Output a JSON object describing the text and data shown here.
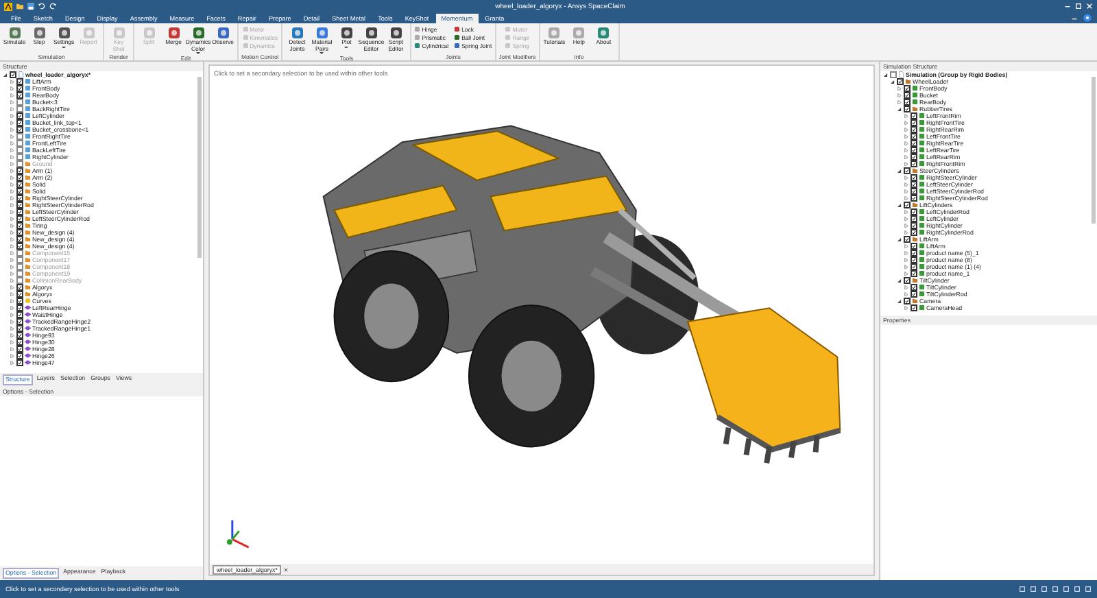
{
  "window": {
    "title": "wheel_loader_algoryx - Ansys SpaceClaim"
  },
  "menu_tabs": [
    {
      "label": "File",
      "selected": false
    },
    {
      "label": "Sketch",
      "selected": false
    },
    {
      "label": "Design",
      "selected": false
    },
    {
      "label": "Display",
      "selected": false
    },
    {
      "label": "Assembly",
      "selected": false
    },
    {
      "label": "Measure",
      "selected": false
    },
    {
      "label": "Facets",
      "selected": false
    },
    {
      "label": "Repair",
      "selected": false
    },
    {
      "label": "Prepare",
      "selected": false
    },
    {
      "label": "Detail",
      "selected": false
    },
    {
      "label": "Sheet Metal",
      "selected": false
    },
    {
      "label": "Tools",
      "selected": false
    },
    {
      "label": "KeyShot",
      "selected": false
    },
    {
      "label": "Momentum",
      "selected": true
    },
    {
      "label": "Granta",
      "selected": false
    }
  ],
  "ribbon_groups": [
    {
      "label": "Simulation",
      "buttons": [
        {
          "label": "Simulate",
          "kind": "large",
          "disabled": false,
          "dropdown": false
        },
        {
          "label": "Step",
          "kind": "large",
          "disabled": false,
          "dropdown": false
        },
        {
          "label": "Settings",
          "kind": "large",
          "disabled": false,
          "dropdown": true
        },
        {
          "label": "Report",
          "kind": "large",
          "disabled": true,
          "dropdown": false
        }
      ]
    },
    {
      "label": "Render",
      "buttons": [
        {
          "label": "Key Shot",
          "kind": "large",
          "disabled": true,
          "dropdown": false
        }
      ]
    },
    {
      "label": "Edit",
      "buttons": [
        {
          "label": "Split",
          "kind": "large",
          "disabled": true,
          "dropdown": false
        },
        {
          "label": "Merge",
          "kind": "large",
          "disabled": false,
          "dropdown": false
        },
        {
          "label": "Dynamics Color",
          "kind": "large",
          "disabled": false,
          "dropdown": true
        },
        {
          "label": "Observe",
          "kind": "large",
          "disabled": false,
          "dropdown": false
        }
      ]
    },
    {
      "label": "Motion Control",
      "buttons": [
        {
          "label": "Motor",
          "kind": "small",
          "disabled": true,
          "dropdown": false
        },
        {
          "label": "Kinematics",
          "kind": "small",
          "disabled": true,
          "dropdown": false
        },
        {
          "label": "Dynamics",
          "kind": "small",
          "disabled": true,
          "dropdown": false
        }
      ]
    },
    {
      "label": "Tools",
      "buttons": [
        {
          "label": "Detect Joints",
          "kind": "large",
          "disabled": false,
          "dropdown": false
        },
        {
          "label": "Material Pairs",
          "kind": "large",
          "disabled": false,
          "dropdown": true
        },
        {
          "label": "Plot",
          "kind": "large",
          "disabled": false,
          "dropdown": true
        },
        {
          "label": "Sequence Editor",
          "kind": "large",
          "disabled": false,
          "dropdown": false
        },
        {
          "label": "Script Editor",
          "kind": "large",
          "disabled": false,
          "dropdown": false
        }
      ]
    },
    {
      "label": "Joints",
      "buttons": [
        {
          "label": "Hinge",
          "kind": "small",
          "disabled": false,
          "dropdown": false
        },
        {
          "label": "Prismatic",
          "kind": "small",
          "disabled": false,
          "dropdown": false
        },
        {
          "label": "Cylindrical",
          "kind": "small",
          "disabled": false,
          "dropdown": false
        },
        {
          "label": "Lock",
          "kind": "small",
          "disabled": false,
          "dropdown": false
        },
        {
          "label": "Ball Joint",
          "kind": "small",
          "disabled": false,
          "dropdown": false
        },
        {
          "label": "Spring Joint",
          "kind": "small",
          "disabled": false,
          "dropdown": false
        }
      ]
    },
    {
      "label": "Joint Modifiers",
      "buttons": [
        {
          "label": "Motor",
          "kind": "small",
          "disabled": true,
          "dropdown": false
        },
        {
          "label": "Range",
          "kind": "small",
          "disabled": true,
          "dropdown": false
        },
        {
          "label": "Spring",
          "kind": "small",
          "disabled": true,
          "dropdown": false
        }
      ]
    },
    {
      "label": "Info",
      "buttons": [
        {
          "label": "Tutorials",
          "kind": "large",
          "disabled": false,
          "dropdown": false
        },
        {
          "label": "Help",
          "kind": "large",
          "disabled": false,
          "dropdown": false
        },
        {
          "label": "About",
          "kind": "large",
          "disabled": false,
          "dropdown": false
        }
      ]
    }
  ],
  "structure_panel": {
    "title": "Structure",
    "tree": {
      "label": "wheel_loader_algoryx*",
      "kind": "document",
      "checked": true,
      "expanded": true,
      "children": [
        {
          "label": "LiftArm",
          "kind": "body",
          "checked": true,
          "expanded": false
        },
        {
          "label": "FrontBody",
          "kind": "body",
          "checked": true,
          "expanded": false
        },
        {
          "label": "RearBody",
          "kind": "body",
          "checked": true,
          "expanded": false
        },
        {
          "label": "Bucket<3",
          "kind": "body",
          "checked": false,
          "expanded": false
        },
        {
          "label": "BackRightTire",
          "kind": "body",
          "checked": false,
          "expanded": false
        },
        {
          "label": "LeftCylinder",
          "kind": "body",
          "checked": true,
          "expanded": false
        },
        {
          "label": "Bucket_link_top<1",
          "kind": "body",
          "checked": true,
          "expanded": false
        },
        {
          "label": "Bucket_crossbone<1",
          "kind": "body",
          "checked": true,
          "expanded": false
        },
        {
          "label": "FrontRightTire",
          "kind": "body",
          "checked": false,
          "expanded": false
        },
        {
          "label": "FrontLeftTire",
          "kind": "body",
          "checked": false,
          "expanded": false
        },
        {
          "label": "BackLeftTire",
          "kind": "body",
          "checked": false,
          "expanded": false
        },
        {
          "label": "RightCylinder",
          "kind": "body",
          "checked": false,
          "expanded": false
        },
        {
          "label": "Ground",
          "kind": "component",
          "checked": false,
          "expanded": false
        },
        {
          "label": "Arm (1)",
          "kind": "component",
          "checked": true,
          "expanded": false
        },
        {
          "label": "Arm (2)",
          "kind": "component",
          "checked": true,
          "expanded": false
        },
        {
          "label": "Solid",
          "kind": "component",
          "checked": true,
          "expanded": false
        },
        {
          "label": "Solid",
          "kind": "component",
          "checked": true,
          "expanded": false
        },
        {
          "label": "RightSteerCylinder",
          "kind": "component",
          "checked": true,
          "expanded": false
        },
        {
          "label": "RightSteerCylinderRod",
          "kind": "component",
          "checked": true,
          "expanded": false
        },
        {
          "label": "LeftSteerCylinder",
          "kind": "component",
          "checked": true,
          "expanded": false
        },
        {
          "label": "LeftSteerCylinderRod",
          "kind": "component",
          "checked": true,
          "expanded": false
        },
        {
          "label": "Tiring",
          "kind": "component",
          "checked": true,
          "expanded": false
        },
        {
          "label": "New_design (4)",
          "kind": "component",
          "checked": true,
          "expanded": false
        },
        {
          "label": "New_design (4)",
          "kind": "component",
          "checked": true,
          "expanded": false
        },
        {
          "label": "New_design (4)",
          "kind": "component",
          "checked": true,
          "expanded": false
        },
        {
          "label": "Component15",
          "kind": "component",
          "checked": false,
          "expanded": false
        },
        {
          "label": "Component17",
          "kind": "component",
          "checked": false,
          "expanded": false
        },
        {
          "label": "Component18",
          "kind": "component",
          "checked": false,
          "expanded": false
        },
        {
          "label": "Component19",
          "kind": "component",
          "checked": false,
          "expanded": false
        },
        {
          "label": "CollisionRearBody",
          "kind": "component",
          "checked": false,
          "expanded": false
        },
        {
          "label": "Algoryx",
          "kind": "component",
          "checked": true,
          "expanded": false
        },
        {
          "label": "Algoryx",
          "kind": "component",
          "checked": true,
          "expanded": false
        },
        {
          "label": "Curves",
          "kind": "curves",
          "checked": true,
          "expanded": false
        },
        {
          "label": "LeftRearHinge",
          "kind": "joint",
          "checked": true,
          "expanded": false
        },
        {
          "label": "WaistHinge",
          "kind": "joint",
          "checked": true,
          "expanded": false
        },
        {
          "label": "TrackedRangeHinge2",
          "kind": "joint",
          "checked": true,
          "expanded": false
        },
        {
          "label": "TrackedRangeHinge1",
          "kind": "joint",
          "checked": true,
          "expanded": false
        },
        {
          "label": "Hinge93",
          "kind": "joint",
          "checked": true,
          "expanded": false
        },
        {
          "label": "Hinge30",
          "kind": "joint",
          "checked": true,
          "expanded": false
        },
        {
          "label": "Hinge28",
          "kind": "joint",
          "checked": true,
          "expanded": false
        },
        {
          "label": "Hinge26",
          "kind": "joint",
          "checked": true,
          "expanded": false
        },
        {
          "label": "Hinge47",
          "kind": "joint",
          "checked": true,
          "expanded": false
        }
      ]
    },
    "tabs": [
      {
        "label": "Structure",
        "selected": true
      },
      {
        "label": "Layers",
        "selected": false
      },
      {
        "label": "Selection",
        "selected": false
      },
      {
        "label": "Groups",
        "selected": false
      },
      {
        "label": "Views",
        "selected": false
      }
    ]
  },
  "options_panel": {
    "title": "Options - Selection",
    "tabs": [
      {
        "label": "Options - Selection",
        "selected": true
      },
      {
        "label": "Appearance",
        "selected": false
      },
      {
        "label": "Playback",
        "selected": false
      }
    ]
  },
  "viewport": {
    "hint": "Click to set a secondary selection to be used within other tools",
    "document_tabs": [
      {
        "label": "wheel_loader_algoryx*",
        "selected": true
      }
    ]
  },
  "simulation_panel": {
    "title": "Simulation Structure",
    "tree": {
      "label": "Simulation (Group by Rigid Bodies)",
      "kind": "simulation",
      "checked": false,
      "expanded": true,
      "children": [
        {
          "label": "WheelLoader",
          "kind": "group",
          "checked": true,
          "expanded": true,
          "children": [
            {
              "label": "FrontBody",
              "kind": "rigid",
              "checked": true,
              "expanded": false
            },
            {
              "label": "Bucket",
              "kind": "rigid",
              "checked": true,
              "expanded": false
            },
            {
              "label": "RearBody",
              "kind": "rigid",
              "checked": true,
              "expanded": false
            },
            {
              "label": "RubberTires",
              "kind": "group",
              "checked": true,
              "expanded": true,
              "children": [
                {
                  "label": "LeftFrontRim",
                  "kind": "rigid",
                  "checked": true,
                  "expanded": false
                },
                {
                  "label": "RightFrontTire",
                  "kind": "rigid",
                  "checked": true,
                  "expanded": false
                },
                {
                  "label": "RightRearRim",
                  "kind": "rigid",
                  "checked": true,
                  "expanded": false
                },
                {
                  "label": "LeftFrontTire",
                  "kind": "rigid",
                  "checked": true,
                  "expanded": false
                },
                {
                  "label": "RightRearTire",
                  "kind": "rigid",
                  "checked": true,
                  "expanded": false
                },
                {
                  "label": "LeftRearTire",
                  "kind": "rigid",
                  "checked": true,
                  "expanded": false
                },
                {
                  "label": "LeftRearRim",
                  "kind": "rigid",
                  "checked": true,
                  "expanded": false
                },
                {
                  "label": "RightFrontRim",
                  "kind": "rigid",
                  "checked": true,
                  "expanded": false
                }
              ]
            },
            {
              "label": "SteerCylinders",
              "kind": "group",
              "checked": true,
              "expanded": true,
              "children": [
                {
                  "label": "RightSteerCylinder",
                  "kind": "rigid",
                  "checked": true,
                  "expanded": false
                },
                {
                  "label": "LeftSteerCylinder",
                  "kind": "rigid",
                  "checked": true,
                  "expanded": false
                },
                {
                  "label": "LeftSteerCylinderRod",
                  "kind": "rigid",
                  "checked": true,
                  "expanded": false
                },
                {
                  "label": "RightSteerCylinderRod",
                  "kind": "rigid",
                  "checked": true,
                  "expanded": false
                }
              ]
            },
            {
              "label": "LiftCylinders",
              "kind": "group",
              "checked": true,
              "expanded": true,
              "children": [
                {
                  "label": "LeftCylinderRod",
                  "kind": "rigid",
                  "checked": true,
                  "expanded": false
                },
                {
                  "label": "LeftCylinder",
                  "kind": "rigid",
                  "checked": true,
                  "expanded": false
                },
                {
                  "label": "RightCylinder",
                  "kind": "rigid",
                  "checked": true,
                  "expanded": false
                },
                {
                  "label": "RightCylinderRod",
                  "kind": "rigid",
                  "checked": true,
                  "expanded": false
                }
              ]
            },
            {
              "label": "LiftArm",
              "kind": "group",
              "checked": true,
              "expanded": true,
              "children": [
                {
                  "label": "LiftArm",
                  "kind": "rigid",
                  "checked": true,
                  "expanded": false
                },
                {
                  "label": "product name (5)_1",
                  "kind": "rigid",
                  "checked": true,
                  "expanded": false
                },
                {
                  "label": "product name (8)",
                  "kind": "rigid",
                  "checked": true,
                  "expanded": false
                },
                {
                  "label": "product name (1) (4)",
                  "kind": "rigid",
                  "checked": true,
                  "expanded": false
                },
                {
                  "label": "product name_1",
                  "kind": "rigid",
                  "checked": true,
                  "expanded": false
                }
              ]
            },
            {
              "label": "TiltCylinder",
              "kind": "group",
              "checked": true,
              "expanded": true,
              "children": [
                {
                  "label": "TiltCylinder",
                  "kind": "rigid",
                  "checked": true,
                  "expanded": false
                },
                {
                  "label": "TiltCylinderRod",
                  "kind": "rigid",
                  "checked": true,
                  "expanded": false
                }
              ]
            },
            {
              "label": "Camera",
              "kind": "group",
              "checked": true,
              "expanded": true,
              "children": [
                {
                  "label": "CameraHead",
                  "kind": "rigid",
                  "checked": true,
                  "expanded": false
                }
              ]
            }
          ]
        }
      ]
    }
  },
  "properties_panel": {
    "title": "Properties"
  },
  "status_bar": {
    "message": "Click to set a secondary selection to be used within other tools"
  }
}
